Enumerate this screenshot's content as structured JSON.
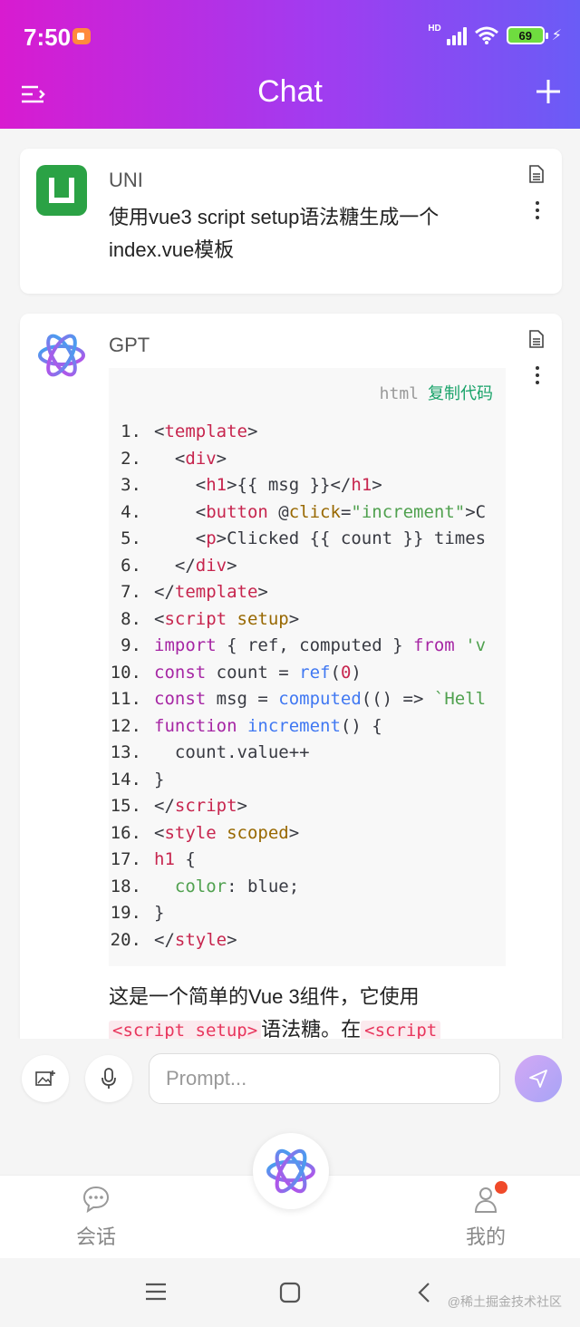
{
  "status_bar": {
    "time": "7:50",
    "network": "HD",
    "battery": "69"
  },
  "nav": {
    "title": "Chat"
  },
  "messages": [
    {
      "author": "UNI",
      "text": "使用vue3 script setup语法糖生成一个index.vue模板"
    },
    {
      "author": "GPT",
      "code": {
        "language": "html",
        "copy_label": "复制代码"
      },
      "answer_prefix": "这是一个简单的Vue 3组件，它使用",
      "inline_code_1": "<script setup>",
      "answer_mid": "语法糖。在",
      "inline_code_2": "<script"
    }
  ],
  "code_lines": [
    {
      "n": "1.",
      "t": [
        [
          "tok-plain",
          "<"
        ],
        [
          "tok-tag",
          "template"
        ],
        [
          "tok-plain",
          ">"
        ]
      ]
    },
    {
      "n": "2.",
      "t": [
        [
          "tok-plain",
          "  <"
        ],
        [
          "tok-tag",
          "div"
        ],
        [
          "tok-plain",
          ">"
        ]
      ]
    },
    {
      "n": "3.",
      "t": [
        [
          "tok-plain",
          "    <"
        ],
        [
          "tok-tag",
          "h1"
        ],
        [
          "tok-plain",
          ">{{ msg }}</"
        ],
        [
          "tok-tag",
          "h1"
        ],
        [
          "tok-plain",
          ">"
        ]
      ]
    },
    {
      "n": "4.",
      "t": [
        [
          "tok-plain",
          "    <"
        ],
        [
          "tok-tag",
          "button"
        ],
        [
          "tok-plain",
          " @"
        ],
        [
          "tok-attr",
          "click"
        ],
        [
          "tok-plain",
          "="
        ],
        [
          "tok-str",
          "\"increment\""
        ],
        [
          "tok-plain",
          ">C"
        ]
      ]
    },
    {
      "n": "5.",
      "t": [
        [
          "tok-plain",
          "    <"
        ],
        [
          "tok-tag",
          "p"
        ],
        [
          "tok-plain",
          ">Clicked {{ count }} times"
        ]
      ]
    },
    {
      "n": "6.",
      "t": [
        [
          "tok-plain",
          "  </"
        ],
        [
          "tok-tag",
          "div"
        ],
        [
          "tok-plain",
          ">"
        ]
      ]
    },
    {
      "n": "7.",
      "t": [
        [
          "tok-plain",
          "</"
        ],
        [
          "tok-tag",
          "template"
        ],
        [
          "tok-plain",
          ">"
        ]
      ]
    },
    {
      "n": "8.",
      "t": [
        [
          "tok-plain",
          "<"
        ],
        [
          "tok-tag",
          "script"
        ],
        [
          "tok-plain",
          " "
        ],
        [
          "tok-attr",
          "setup"
        ],
        [
          "tok-plain",
          ">"
        ]
      ]
    },
    {
      "n": "9.",
      "t": [
        [
          "tok-kw",
          "import"
        ],
        [
          "tok-plain",
          " { ref, computed } "
        ],
        [
          "tok-kw",
          "from"
        ],
        [
          "tok-plain",
          " "
        ],
        [
          "tok-str",
          "'v"
        ]
      ]
    },
    {
      "n": "10.",
      "t": [
        [
          "tok-kw",
          "const"
        ],
        [
          "tok-plain",
          " count = "
        ],
        [
          "tok-fn",
          "ref"
        ],
        [
          "tok-plain",
          "("
        ],
        [
          "tok-num",
          "0"
        ],
        [
          "tok-plain",
          ")"
        ]
      ]
    },
    {
      "n": "11.",
      "t": [
        [
          "tok-kw",
          "const"
        ],
        [
          "tok-plain",
          " msg = "
        ],
        [
          "tok-fn",
          "computed"
        ],
        [
          "tok-plain",
          "(() => "
        ],
        [
          "tok-str",
          "`Hell"
        ]
      ]
    },
    {
      "n": "12.",
      "t": [
        [
          "tok-kw",
          "function"
        ],
        [
          "tok-plain",
          " "
        ],
        [
          "tok-fn",
          "increment"
        ],
        [
          "tok-plain",
          "() {"
        ]
      ]
    },
    {
      "n": "13.",
      "t": [
        [
          "tok-plain",
          "  count.value++"
        ]
      ]
    },
    {
      "n": "14.",
      "t": [
        [
          "tok-plain",
          "}"
        ]
      ]
    },
    {
      "n": "15.",
      "t": [
        [
          "tok-plain",
          "</"
        ],
        [
          "tok-tag",
          "script"
        ],
        [
          "tok-plain",
          ">"
        ]
      ]
    },
    {
      "n": "16.",
      "t": [
        [
          "tok-plain",
          "<"
        ],
        [
          "tok-tag",
          "style"
        ],
        [
          "tok-plain",
          " "
        ],
        [
          "tok-attr",
          "scoped"
        ],
        [
          "tok-plain",
          ">"
        ]
      ]
    },
    {
      "n": "17.",
      "t": [
        [
          "tok-tag",
          "h1"
        ],
        [
          "tok-plain",
          " {"
        ]
      ]
    },
    {
      "n": "18.",
      "t": [
        [
          "tok-plain",
          "  "
        ],
        [
          "tok-str",
          "color"
        ],
        [
          "tok-plain",
          ": blue;"
        ]
      ]
    },
    {
      "n": "19.",
      "t": [
        [
          "tok-plain",
          "}"
        ]
      ]
    },
    {
      "n": "20.",
      "t": [
        [
          "tok-plain",
          "</"
        ],
        [
          "tok-tag",
          "style"
        ],
        [
          "tok-plain",
          ">"
        ]
      ]
    }
  ],
  "input": {
    "placeholder": "Prompt..."
  },
  "tabs": {
    "chat_label": "会话",
    "me_label": "我的"
  },
  "watermark": "@稀土掘金技术社区",
  "colors": {
    "header_gradient": [
      "#d81bd0",
      "#6a5cf6"
    ],
    "copy_link": "#1aa36a",
    "badge": "#f04a2a",
    "uni_avatar": "#2ba245"
  },
  "icons": [
    "menu-icon",
    "plus-icon",
    "doc-icon",
    "more-icon",
    "image-icon",
    "mic-icon",
    "send-icon",
    "chat-bubble-icon",
    "user-icon",
    "openai-logo-icon"
  ]
}
